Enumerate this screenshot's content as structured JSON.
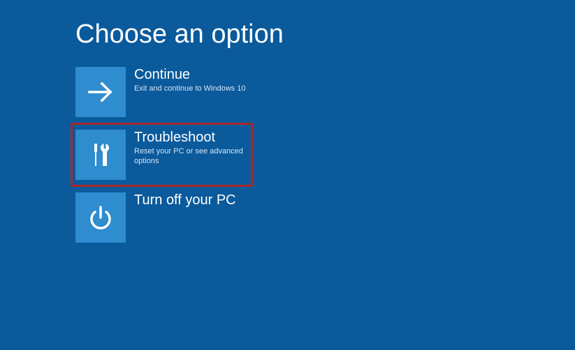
{
  "page": {
    "title": "Choose an option"
  },
  "options": {
    "continue": {
      "title": "Continue",
      "subtitle": "Exit and continue to Windows 10"
    },
    "troubleshoot": {
      "title": "Troubleshoot",
      "subtitle": "Reset your PC or see advanced options"
    },
    "turn_off": {
      "title": "Turn off your PC"
    }
  },
  "colors": {
    "background": "#0a5a9c",
    "tile": "#2e8ccf",
    "highlight_border": "#a6282c"
  }
}
